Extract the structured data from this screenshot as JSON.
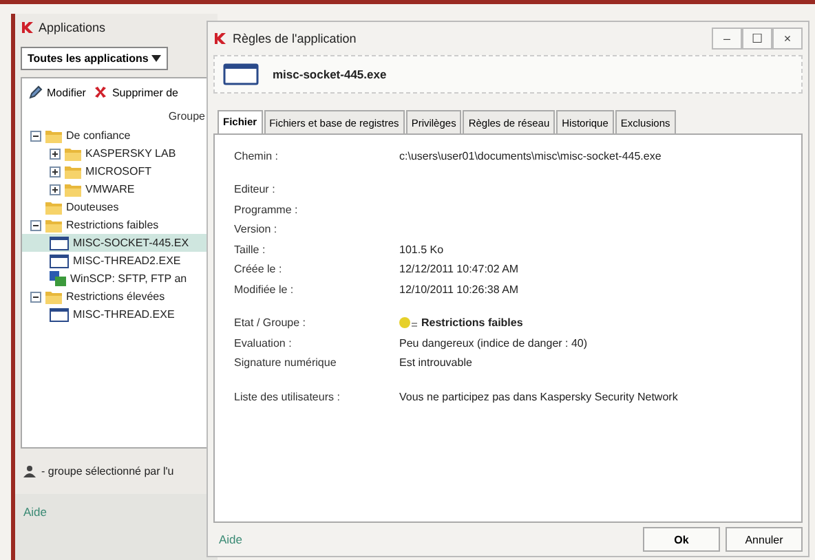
{
  "apps_window": {
    "title": "Applications",
    "filter": "Toutes les applications",
    "toolbar": [
      {
        "kind": "edit",
        "label": "Modifier"
      },
      {
        "kind": "delete",
        "label": "Supprimer de"
      }
    ],
    "column_header": "Groupe",
    "tree": [
      {
        "kind": "folder",
        "label": "De confiance",
        "expanded": true,
        "children": [
          {
            "kind": "folder",
            "label": "KASPERSKY LAB",
            "expanded": false
          },
          {
            "kind": "folder",
            "label": "MICROSOFT",
            "expanded": false
          },
          {
            "kind": "folder",
            "label": "VMWARE",
            "expanded": false
          }
        ]
      },
      {
        "kind": "folder",
        "label": "Douteuses"
      },
      {
        "kind": "folder",
        "label": "Restrictions faibles",
        "expanded": true,
        "children": [
          {
            "kind": "app",
            "label": "MISC-SOCKET-445.EX",
            "selected": true
          },
          {
            "kind": "app",
            "label": "MISC-THREAD2.EXE",
            "selected": false
          },
          {
            "kind": "program",
            "label": "WinSCP: SFTP, FTP an",
            "selected": false
          }
        ]
      },
      {
        "kind": "folder",
        "label": "Restrictions élevées",
        "expanded": true,
        "children": [
          {
            "kind": "app",
            "label": "MISC-THREAD.EXE",
            "selected": false
          }
        ]
      }
    ],
    "legend": "- groupe sélectionné par l'u",
    "help": "Aide"
  },
  "dialog": {
    "title": "Règles de l'application",
    "window_buttons": [
      "–",
      "☐",
      "×"
    ],
    "app_name": "misc-socket-445.exe",
    "tabs": [
      {
        "label": "Fichier",
        "selected": true
      },
      {
        "label": "Fichiers et base de registres",
        "selected": false
      },
      {
        "label": "Privilèges",
        "selected": false
      },
      {
        "label": "Règles de réseau",
        "selected": false
      },
      {
        "label": "Historique",
        "selected": false
      },
      {
        "label": "Exclusions",
        "selected": false
      }
    ],
    "sections": [
      [
        {
          "label": "Chemin :",
          "value": "c:\\users\\user01\\documents\\misc\\misc-socket-445.exe"
        }
      ],
      [
        {
          "label": "Editeur :"
        },
        {
          "label": "Programme :"
        },
        {
          "label": "Version :"
        },
        {
          "label": "Taille :",
          "value": "101.5 Ko"
        },
        {
          "label": "Créée le :",
          "value": "12/12/2011 10:47:02 AM"
        },
        {
          "label": "Modifiée le :",
          "value": "12/10/2011 10:26:38 AM"
        }
      ],
      [
        {
          "label": "Etat / Groupe :",
          "value": "Restrictions faibles",
          "kind": "status"
        },
        {
          "label": "Evaluation :",
          "value": "Peu dangereux (indice de danger : 40)"
        },
        {
          "label": "Signature numérique",
          "value": "Est introuvable"
        }
      ],
      [
        {
          "label": "Liste des utilisateurs :",
          "value": "Vous ne participez pas dans Kaspersky Security Network"
        }
      ]
    ],
    "help": "Aide",
    "buttons": [
      "Ok",
      "Annuler"
    ]
  }
}
